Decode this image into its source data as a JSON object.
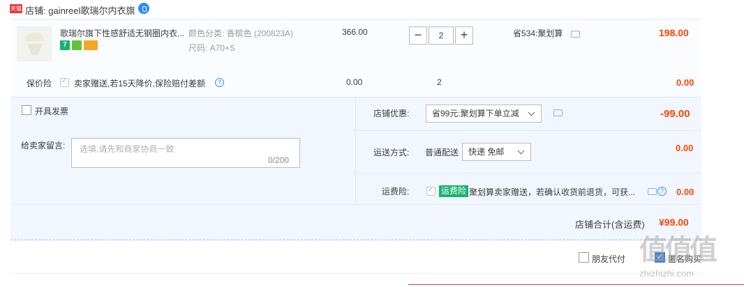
{
  "shop": {
    "tag": "天猫",
    "name": "店铺: gainreel歌瑞尔内衣旗"
  },
  "item": {
    "title": "歌瑞尔旗下性感舒适无钢圈内衣...",
    "badge_seven": "7",
    "sku_color": "颜色分类: 香槟色 (200823A)",
    "sku_size": "尺码: A70+S",
    "unit_price": "366.00",
    "qty_minus": "−",
    "qty": "2",
    "qty_plus": "+",
    "promo": "省534:聚划算",
    "total": "198.00"
  },
  "insurance": {
    "label": "保价险",
    "text": "卖家赠送,若15天降价,保险赔付差额",
    "help": "?",
    "price": "0.00",
    "qty": "2",
    "total": "0.00"
  },
  "options": {
    "invoice": "开具发票",
    "memo_label": "给卖家留言:",
    "memo_placeholder": "选填,请先和商家协商一致",
    "memo_count": "0/200",
    "discount_label": "店铺优惠:",
    "discount_selected": "省99元:聚划算下单立减",
    "discount_value": "-99.00",
    "ship_label": "运送方式:",
    "ship_type": "普通配送",
    "ship_selected": "快递 免邮",
    "ship_value": "0.00",
    "freight_label": "运费险:",
    "freight_tag": "运费险",
    "freight_text": "聚划算卖家赠送，若确认收货前退货，可获...",
    "freight_help": "?",
    "freight_value": "0.00",
    "sum_label": "店铺合计(含运费)",
    "sum_value": "¥99.00"
  },
  "footer": {
    "friend_pay": "朋友代付",
    "anon_check": "✓",
    "anonymous": "匿名购买"
  },
  "watermark": {
    "logo": "值值值",
    "site": "zhizhizhi.com"
  },
  "colors": {
    "price_red": "#ff4400",
    "accent_blue": "#2a8dff",
    "panel_bg": "#f2f7ff",
    "tag_green": "#18b36e"
  },
  "icons": [
    "tmall-logo",
    "wangwang-icon",
    "message-icon",
    "help-icon",
    "chevron-down-icon"
  ]
}
